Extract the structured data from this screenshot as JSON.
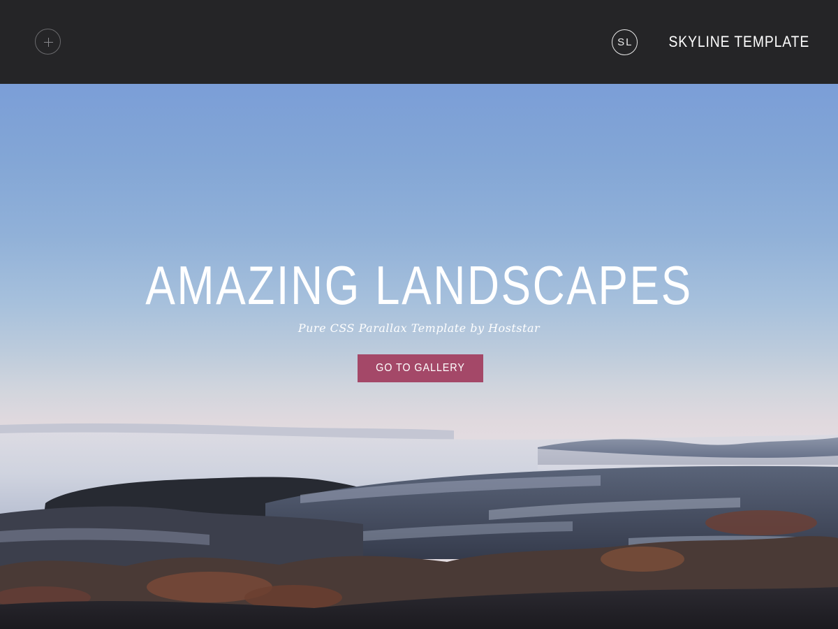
{
  "header": {
    "menu_icon": "plus-icon",
    "brand_mark": "SL",
    "brand_name": "SKYLINE TEMPLATE"
  },
  "hero": {
    "title": "AMAZING LANDSCAPES",
    "subtitle": "Pure CSS Parallax Template by Hoststar",
    "cta_label": "GO TO GALLERY",
    "background": "misty-landscape-photo"
  },
  "colors": {
    "topbar": "#252527",
    "accent": "#a44868",
    "text": "#ffffff"
  }
}
